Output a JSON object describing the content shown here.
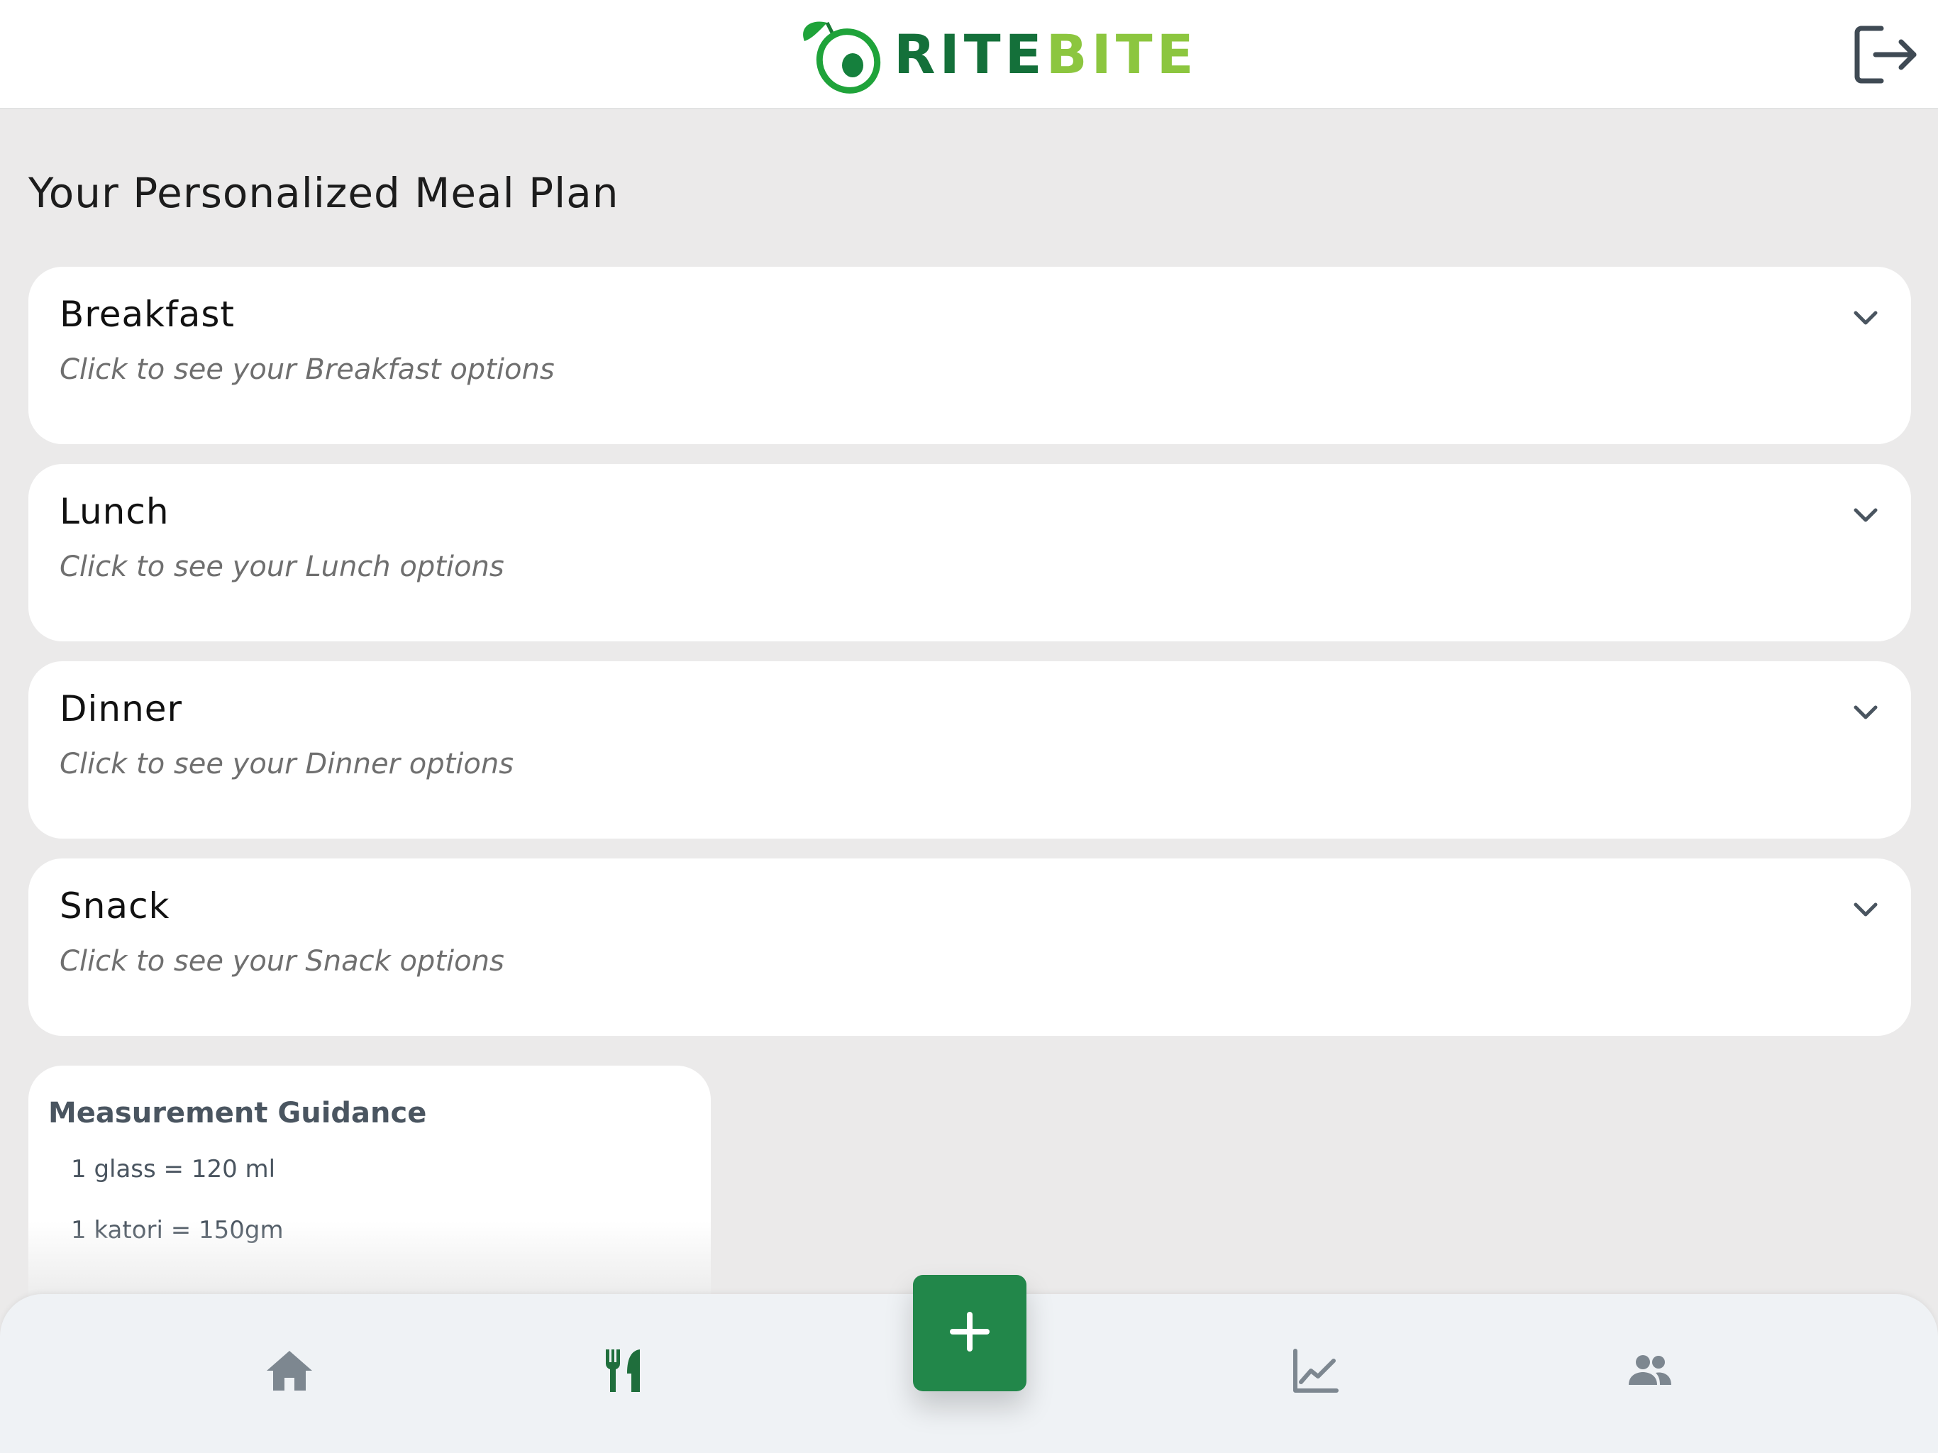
{
  "header": {
    "logo_rite": "RITE",
    "logo_bite": "BITE",
    "logo_icon": "avocado-icon",
    "logout_icon": "logout-icon"
  },
  "main": {
    "title": "Your Personalized Meal Plan",
    "meals": [
      {
        "title": "Breakfast",
        "subtitle": "Click to see your Breakfast options"
      },
      {
        "title": "Lunch",
        "subtitle": "Click to see your Lunch options"
      },
      {
        "title": "Dinner",
        "subtitle": "Click to see your Dinner options"
      },
      {
        "title": "Snack",
        "subtitle": "Click to see your Snack options"
      }
    ],
    "guidance": {
      "title": "Measurement Guidance",
      "items": [
        "1 glass = 120 ml",
        "1 katori = 150gm"
      ]
    }
  },
  "bottom_nav": {
    "items": [
      {
        "icon": "home-icon",
        "active": false
      },
      {
        "icon": "utensils-icon",
        "active": true
      },
      {
        "icon": "chart-icon",
        "active": false
      },
      {
        "icon": "people-icon",
        "active": false
      }
    ],
    "add_icon": "plus-icon"
  },
  "colors": {
    "brand_dark": "#14703a",
    "brand_light": "#8cc63f",
    "accent": "#22874a",
    "nav_inactive": "#7d8790",
    "nav_active": "#1f6e3c"
  }
}
